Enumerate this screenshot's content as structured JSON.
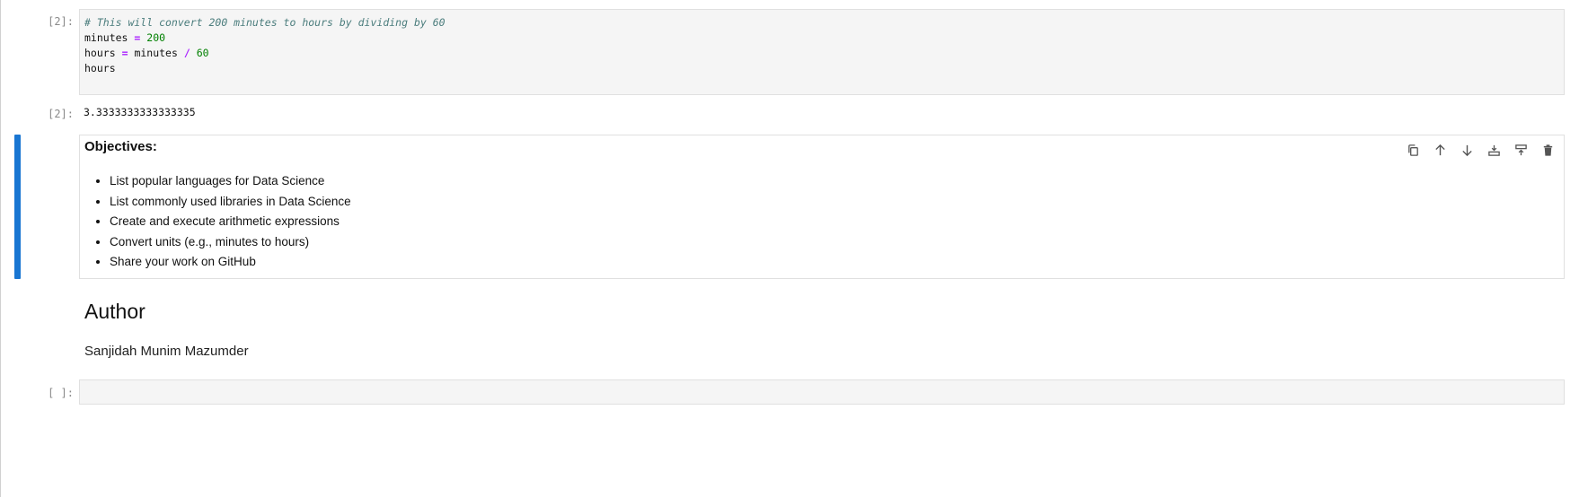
{
  "cells": {
    "code1": {
      "prompt": "[2]:",
      "comment": "# This will convert 200 minutes to hours by dividing by 60",
      "line2_var": "minutes",
      "line2_op": "=",
      "line2_num": "200",
      "line3_var": "hours",
      "line3_eq": "=",
      "line3_var2": "minutes",
      "line3_op": "/",
      "line3_num": "60",
      "line4": "hours"
    },
    "output1": {
      "prompt": "[2]:",
      "value": "3.3333333333333335"
    },
    "markdown_objectives": {
      "heading": "Objectives:",
      "items": [
        "List popular languages for Data Science",
        "List commonly used libraries in Data Science",
        "Create and execute arithmetic expressions",
        "Convert units (e.g., minutes to hours)",
        "Share your work on GitHub"
      ]
    },
    "markdown_author": {
      "heading": "Author",
      "name": "Sanjidah Munim Mazumder"
    },
    "empty": {
      "prompt": "[ ]:"
    }
  },
  "toolbar": {
    "icons": [
      "duplicate-icon",
      "move-up-icon",
      "move-down-icon",
      "insert-below-icon",
      "insert-above-icon",
      "delete-icon"
    ]
  },
  "colors": {
    "active_cell_bar": "#1976d2",
    "code_background": "#f5f5f5",
    "comment": "#4b7d7d",
    "operator": "#aa22ff",
    "number": "#008000"
  }
}
